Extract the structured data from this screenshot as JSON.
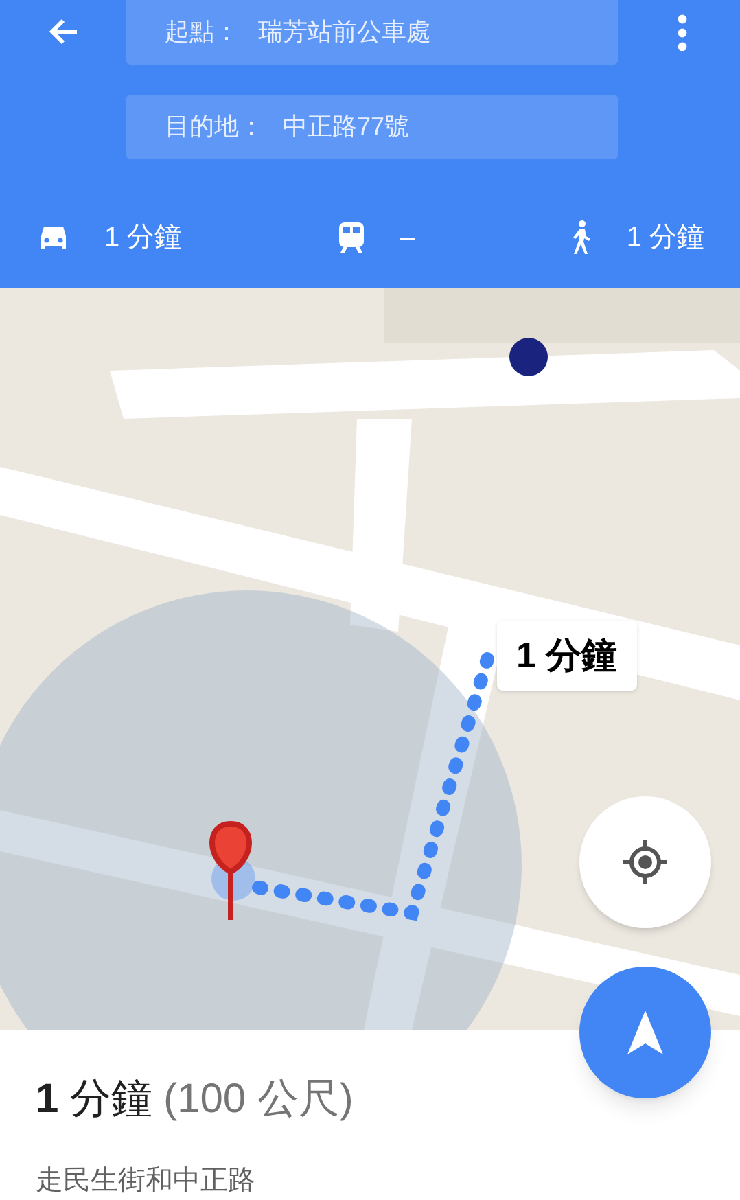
{
  "header": {
    "origin": {
      "label": "起點：",
      "value": "瑞芳站前公車處"
    },
    "destination": {
      "label": "目的地：",
      "value": "中正路77號"
    }
  },
  "modes": [
    {
      "kind": "car",
      "time": "1 分鐘"
    },
    {
      "kind": "transit",
      "time": "–"
    },
    {
      "kind": "walk",
      "time": "1 分鐘"
    }
  ],
  "map": {
    "route_label": "1 分鐘"
  },
  "summary": {
    "duration": "**1** 分鐘",
    "distance": "(100 公尺)",
    "via": "走民生街和中正路"
  }
}
